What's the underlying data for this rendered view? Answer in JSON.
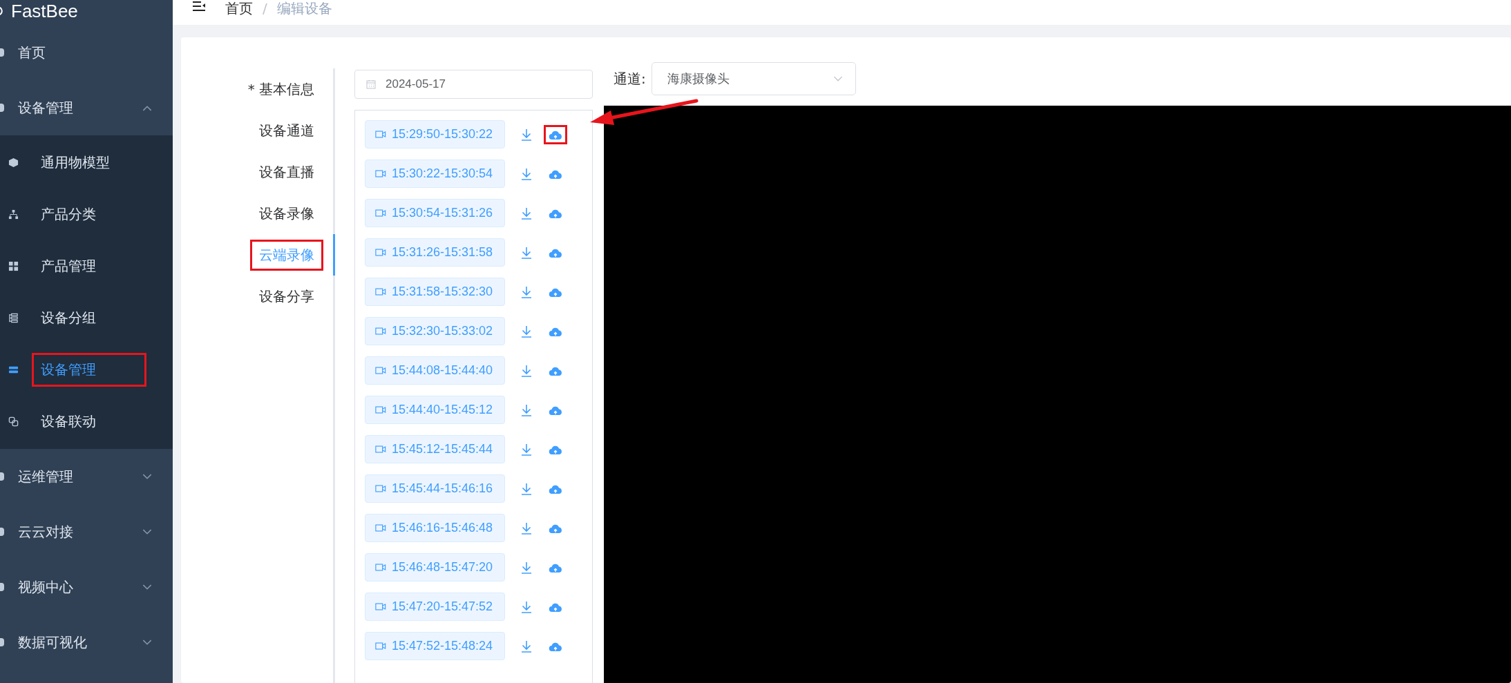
{
  "sidebar": {
    "logo": "FastBee",
    "items": [
      {
        "label": "首页",
        "kind": "link"
      },
      {
        "label": "设备管理",
        "kind": "group",
        "expanded": true,
        "children": [
          {
            "label": "通用物模型",
            "selected": false,
            "annotated": false
          },
          {
            "label": "产品分类",
            "selected": false,
            "annotated": false
          },
          {
            "label": "产品管理",
            "selected": false,
            "annotated": false
          },
          {
            "label": "设备分组",
            "selected": false,
            "annotated": false
          },
          {
            "label": "设备管理",
            "selected": true,
            "annotated": true
          },
          {
            "label": "设备联动",
            "selected": false,
            "annotated": false
          }
        ]
      },
      {
        "label": "运维管理",
        "kind": "group",
        "expanded": false
      },
      {
        "label": "云云对接",
        "kind": "group",
        "expanded": false
      },
      {
        "label": "视频中心",
        "kind": "group",
        "expanded": false
      },
      {
        "label": "数据可视化",
        "kind": "group",
        "expanded": false
      }
    ]
  },
  "breadcrumb": {
    "items": [
      "首页",
      "编辑设备"
    ],
    "separator": "/"
  },
  "tabs": [
    {
      "label": "* 基本信息",
      "selected": false,
      "annotated": false
    },
    {
      "label": "设备通道",
      "selected": false,
      "annotated": false
    },
    {
      "label": "设备直播",
      "selected": false,
      "annotated": false
    },
    {
      "label": "设备录像",
      "selected": false,
      "annotated": false
    },
    {
      "label": "云端录像",
      "selected": true,
      "annotated": true
    },
    {
      "label": "设备分享",
      "selected": false,
      "annotated": false
    }
  ],
  "date_field": {
    "value": "2024-05-17"
  },
  "channel": {
    "label": "通道:",
    "value": "海康摄像头"
  },
  "recordings": [
    {
      "time": "15:29:50-15:30:22",
      "annotated": true
    },
    {
      "time": "15:30:22-15:30:54",
      "annotated": false
    },
    {
      "time": "15:30:54-15:31:26",
      "annotated": false
    },
    {
      "time": "15:31:26-15:31:58",
      "annotated": false
    },
    {
      "time": "15:31:58-15:32:30",
      "annotated": false
    },
    {
      "time": "15:32:30-15:33:02",
      "annotated": false
    },
    {
      "time": "15:44:08-15:44:40",
      "annotated": false
    },
    {
      "time": "15:44:40-15:45:12",
      "annotated": false
    },
    {
      "time": "15:45:12-15:45:44",
      "annotated": false
    },
    {
      "time": "15:45:44-15:46:16",
      "annotated": false
    },
    {
      "time": "15:46:16-15:46:48",
      "annotated": false
    },
    {
      "time": "15:46:48-15:47:20",
      "annotated": false
    },
    {
      "time": "15:47:20-15:47:52",
      "annotated": false
    },
    {
      "time": "15:47:52-15:48:24",
      "annotated": false
    }
  ]
}
